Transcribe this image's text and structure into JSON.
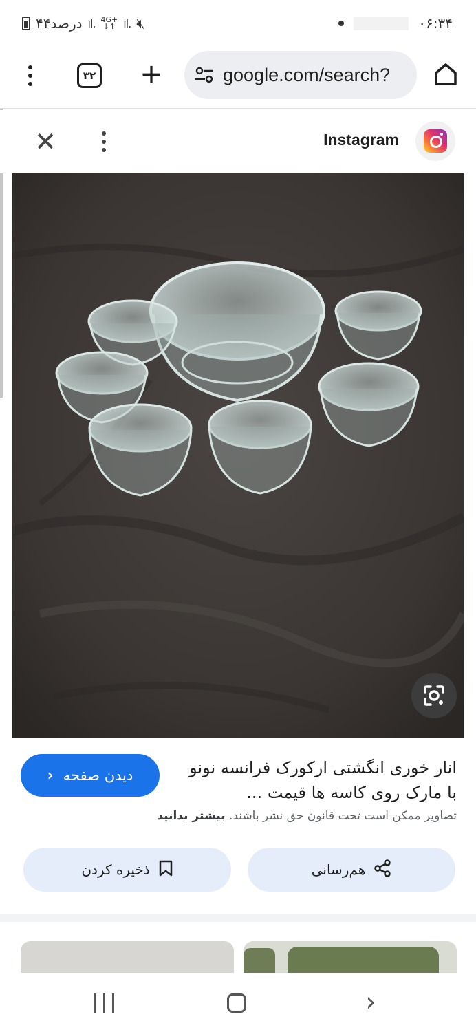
{
  "status_bar": {
    "battery_text": "۴۴درصد",
    "network_label": "4G+",
    "time": "۰۶:۳۴"
  },
  "toolbar": {
    "tab_count": "۳۲",
    "url": "google.com/search?"
  },
  "panel": {
    "source_name": "Instagram"
  },
  "result": {
    "title": "انار خوری انگشتی ارکورک فرانسه نونو با مارک روی کاسه ها قیمت ...",
    "visit_label": "دیدن صفحه",
    "copyright_text": "تصاویر ممکن است تحت قانون حق نشر باشند.",
    "learn_more": "بیشتر بدانید",
    "share_label": "هم‌رسانی",
    "save_label": "ذخیره کردن"
  },
  "icons": {
    "status": [
      "battery-icon",
      "signal-icon",
      "network-icon",
      "mute-icon"
    ],
    "toolbar": [
      "menu-icon",
      "tab-switcher-icon",
      "plus-icon",
      "tune-icon",
      "home-icon"
    ],
    "panel": [
      "close-icon",
      "more-vert-icon",
      "instagram-logo",
      "google-lens-icon"
    ],
    "actions": [
      "chevron-left-icon",
      "share-icon",
      "bookmark-icon"
    ],
    "nav": [
      "recents-icon",
      "home-nav-icon",
      "back-icon"
    ]
  },
  "colors": {
    "primary_button": "#1a73e8",
    "action_button_bg": "#e5edfb",
    "url_bar_bg": "#eceef1"
  }
}
